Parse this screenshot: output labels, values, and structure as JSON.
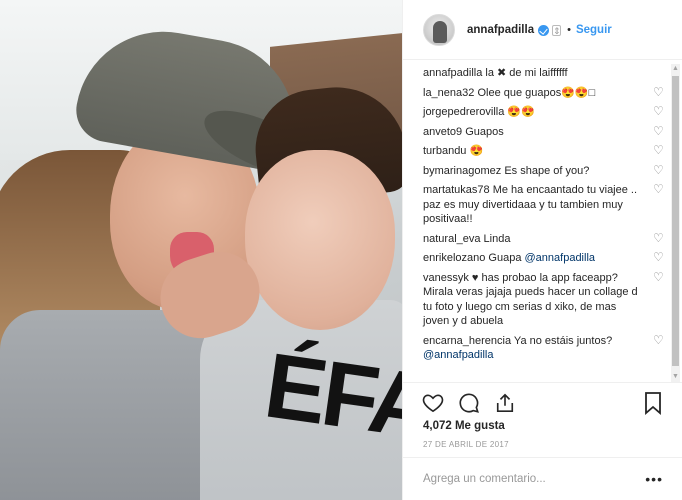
{
  "post": {
    "username": "annafpadilla",
    "follow_label": "Seguir",
    "likes": "4,072 Me gusta",
    "date": "27 DE ABRIL DE 2017",
    "add_comment_placeholder": "Agrega un comentario...",
    "more_icon": "more-options-icon",
    "photo_print_text": "ÉFAV"
  },
  "comments": [
    {
      "user": "annafpadilla",
      "text": " la ✖ de mi laiffffff",
      "mention": ""
    },
    {
      "user": "la_nena32",
      "text": " Olee que guapos😍😍□",
      "mention": ""
    },
    {
      "user": "jorgepedrerovilla",
      "text": " 😍😍",
      "mention": ""
    },
    {
      "user": "anveto9",
      "text": " Guapos",
      "mention": ""
    },
    {
      "user": "turbandu",
      "text": " 😍",
      "mention": ""
    },
    {
      "user": "bymarinagomez",
      "text": " Es shape of you?",
      "mention": ""
    },
    {
      "user": "martatukas78",
      "text": " Me ha encaantado tu viajee .. paz es muy divertidaaa y tu tambien muy positivaa!!",
      "mention": ""
    },
    {
      "user": "natural_eva",
      "text": " Linda",
      "mention": ""
    },
    {
      "user": "enrikelozano",
      "text": " Guapa ",
      "mention": "@annafpadilla"
    },
    {
      "user": "vanessyk",
      "text": " ♥ has probao la app faceapp? Mirala veras jajaja pueds hacer un collage d tu foto y luego cm serias d xiko, de mas joven y d abuela",
      "mention": ""
    },
    {
      "user": "encarna_herencia",
      "text": " Ya no estáis juntos? ",
      "mention": "@annafpadilla"
    }
  ],
  "icons": [
    "heart-icon",
    "comment-icon",
    "share-icon",
    "bookmark-icon",
    "verified-badge-icon"
  ]
}
